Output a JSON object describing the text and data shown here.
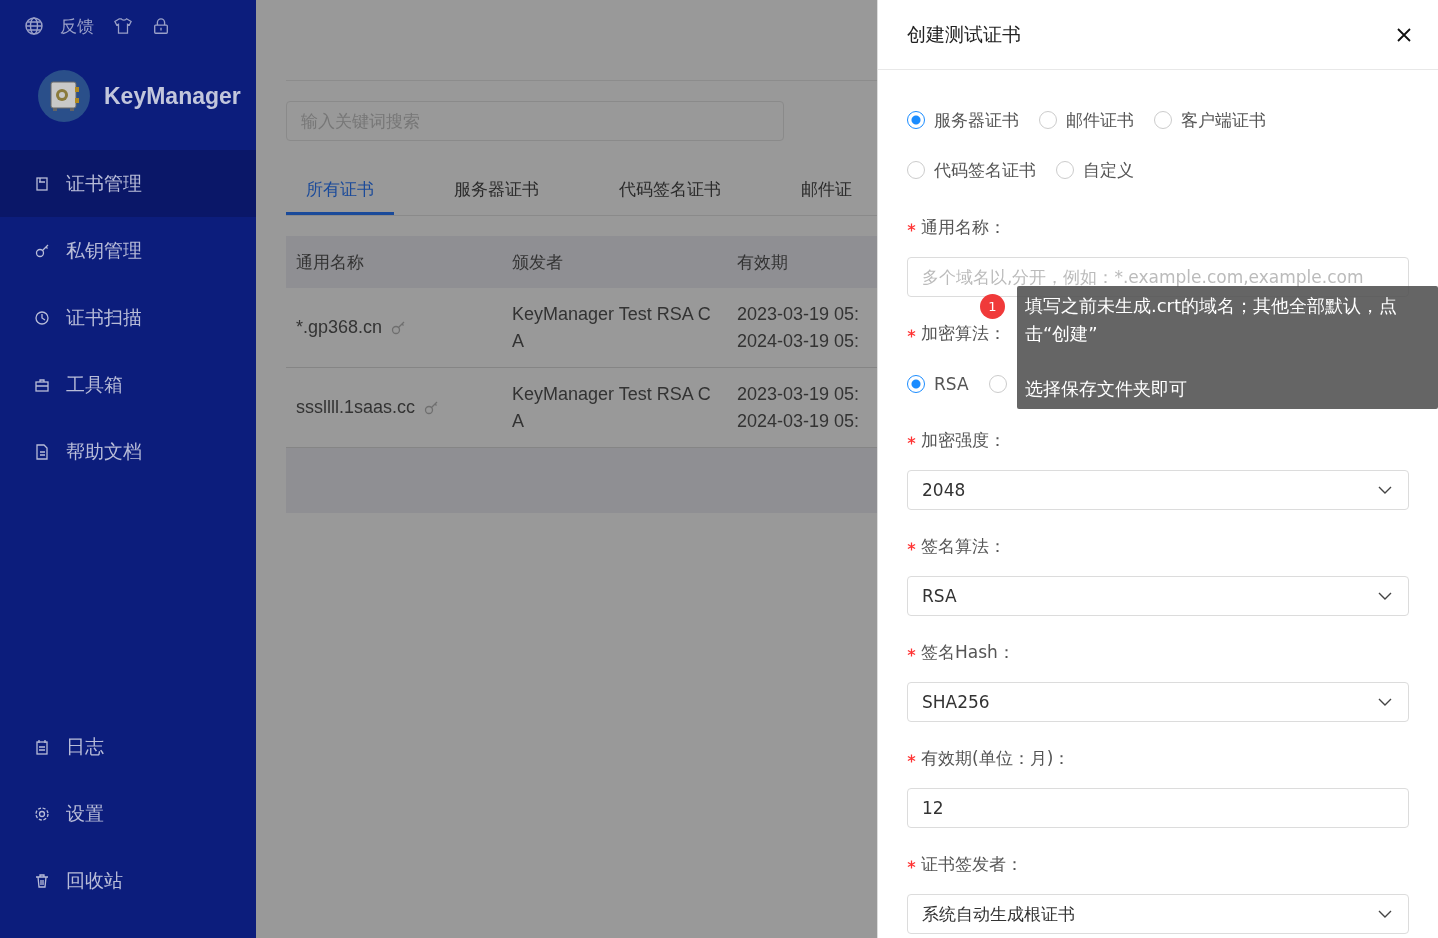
{
  "topbar": {
    "feedback": "反馈"
  },
  "brand": {
    "name": "KeyManager"
  },
  "nav": [
    {
      "label": "证书管理",
      "selected": true
    },
    {
      "label": "私钥管理",
      "selected": false
    },
    {
      "label": "证书扫描",
      "selected": false
    },
    {
      "label": "工具箱",
      "selected": false
    },
    {
      "label": "帮助文档",
      "selected": false
    }
  ],
  "nav_bottom": [
    {
      "label": "日志",
      "selected": false
    },
    {
      "label": "设置",
      "selected": false
    },
    {
      "label": "回收站",
      "selected": false
    }
  ],
  "search": {
    "placeholder": "输入关键词搜索"
  },
  "tabs": [
    {
      "label": "所有证书",
      "selected": true
    },
    {
      "label": "服务器证书",
      "selected": false
    },
    {
      "label": "代码签名证书",
      "selected": false
    },
    {
      "label": "邮件证",
      "selected": false
    }
  ],
  "table": {
    "columns": [
      "通用名称",
      "颁发者",
      "有效期"
    ],
    "rows": [
      {
        "name": "*.gp368.cn",
        "issuer": "KeyManager Test RSA CA",
        "valid_from": "2023-03-19 05:",
        "valid_to": "2024-03-19 05:"
      },
      {
        "name": "sssllll.1saas.cc",
        "issuer": "KeyManager Test RSA CA",
        "valid_from": "2023-03-19 05:",
        "valid_to": "2024-03-19 05:"
      }
    ]
  },
  "drawer": {
    "title": "创建测试证书",
    "fields": [
      {
        "kind": "radio",
        "options": [
          {
            "label": "服务器证书",
            "selected": true
          },
          {
            "label": "邮件证书",
            "selected": false
          },
          {
            "label": "客户端证书",
            "selected": false
          },
          {
            "label": "代码签名证书",
            "selected": false
          },
          {
            "label": "自定义",
            "selected": false
          }
        ]
      },
      {
        "kind": "input",
        "label": "通用名称：",
        "required": true,
        "placeholder": "多个域名以,分开，例如：*.example.com,example.com"
      },
      {
        "kind": "radio",
        "label": "加密算法：",
        "required": true,
        "options": [
          {
            "label": "RSA",
            "selected": true
          },
          {
            "selected": false
          }
        ]
      },
      {
        "kind": "select",
        "label": "加密强度：",
        "required": true,
        "value": "2048"
      },
      {
        "kind": "select",
        "label": "签名算法：",
        "required": true,
        "value": "RSA"
      },
      {
        "kind": "select",
        "label": "签名Hash：",
        "required": true,
        "value": "SHA256"
      },
      {
        "kind": "input",
        "label": "有效期(单位：月)：",
        "required": true,
        "value": "12"
      },
      {
        "kind": "select",
        "label": "证书签发者：",
        "required": true,
        "value": "系统自动生成根证书"
      }
    ]
  },
  "tooltip": {
    "badge": "1",
    "paragraphs": [
      "填写之前未生成.crt的域名；其他全部默认，点击“创建”",
      "选择保存文件夹即可"
    ]
  }
}
